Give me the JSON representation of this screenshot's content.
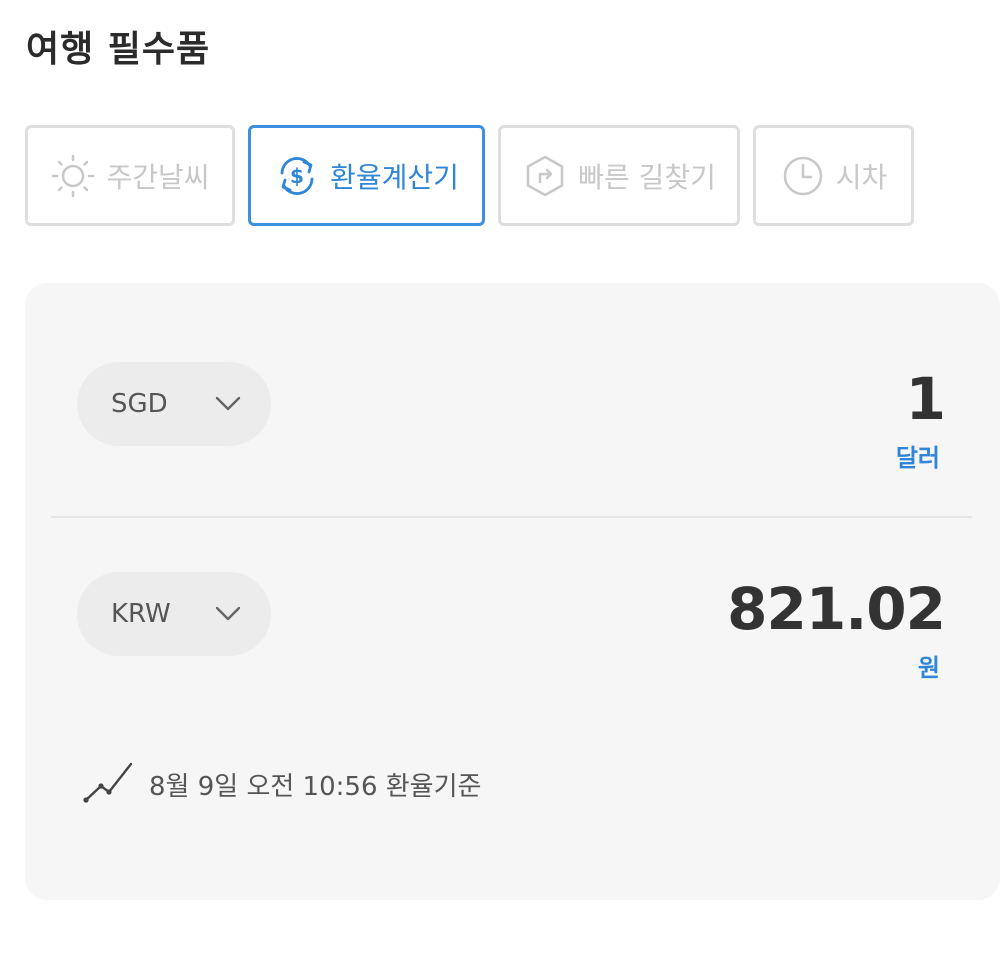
{
  "header": {
    "title": "여행 필수품"
  },
  "tabs": [
    {
      "label": "주간날씨",
      "icon": "sun-icon",
      "active": false
    },
    {
      "label": "환율계산기",
      "icon": "currency-exchange-icon",
      "active": true
    },
    {
      "label": "빠른 길찾기",
      "icon": "directions-icon",
      "active": false
    },
    {
      "label": "시차",
      "icon": "clock-icon",
      "active": false
    }
  ],
  "converter": {
    "from": {
      "currency": "SGD",
      "amount": "1",
      "unit": "달러"
    },
    "to": {
      "currency": "KRW",
      "amount": "821.02",
      "unit": "원"
    },
    "rate_note": "8월 9일 오전 10:56 환율기준"
  },
  "colors": {
    "accent": "#2f86d8",
    "panel_bg": "#f6f6f6",
    "inactive_tab": "#c8c8c8"
  }
}
